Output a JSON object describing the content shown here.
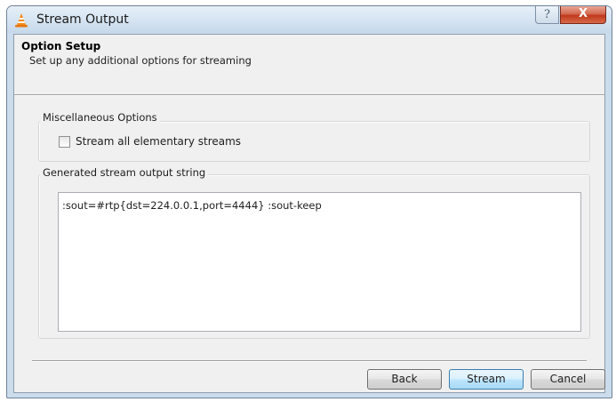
{
  "window": {
    "title": "Stream Output",
    "help_label": "?",
    "close_label": "X"
  },
  "header": {
    "title": "Option Setup",
    "subtitle": "Set up any additional options for streaming"
  },
  "misc_options": {
    "group_label": "Miscellaneous Options",
    "checkbox_label": "Stream all elementary streams",
    "checked": false
  },
  "generated": {
    "group_label": "Generated stream output string",
    "value": ":sout=#rtp{dst=224.0.0.1,port=4444} :sout-keep"
  },
  "buttons": {
    "back": "Back",
    "stream": "Stream",
    "cancel": "Cancel"
  },
  "colors": {
    "title_bar": "#d8e6f3",
    "close_button": "#c1391c",
    "dialog_bg": "#f0f0f0",
    "default_button": "#bee6fd"
  },
  "icons": {
    "app": "vlc-cone-icon"
  }
}
